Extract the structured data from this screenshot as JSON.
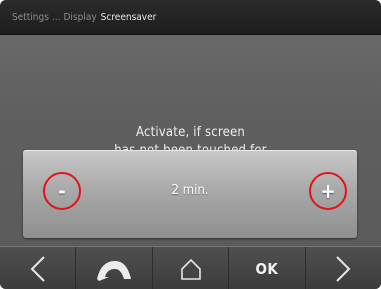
{
  "breadcrumb": {
    "items": [
      "Settings",
      "Display"
    ],
    "separator": "...",
    "current": "Screensaver"
  },
  "prompt": {
    "line1": "Activate, if screen",
    "line2": "has not been touched for"
  },
  "timeout": {
    "decrease_label": "-",
    "value": "2 min.",
    "increase_label": "+"
  },
  "navbar": {
    "left_icon": "left-arrow-icon",
    "back_icon": "back-arrow-icon",
    "home_icon": "home-icon",
    "ok_label": "OK",
    "right_icon": "right-arrow-icon"
  },
  "colors": {
    "highlight": "#e1141a"
  }
}
